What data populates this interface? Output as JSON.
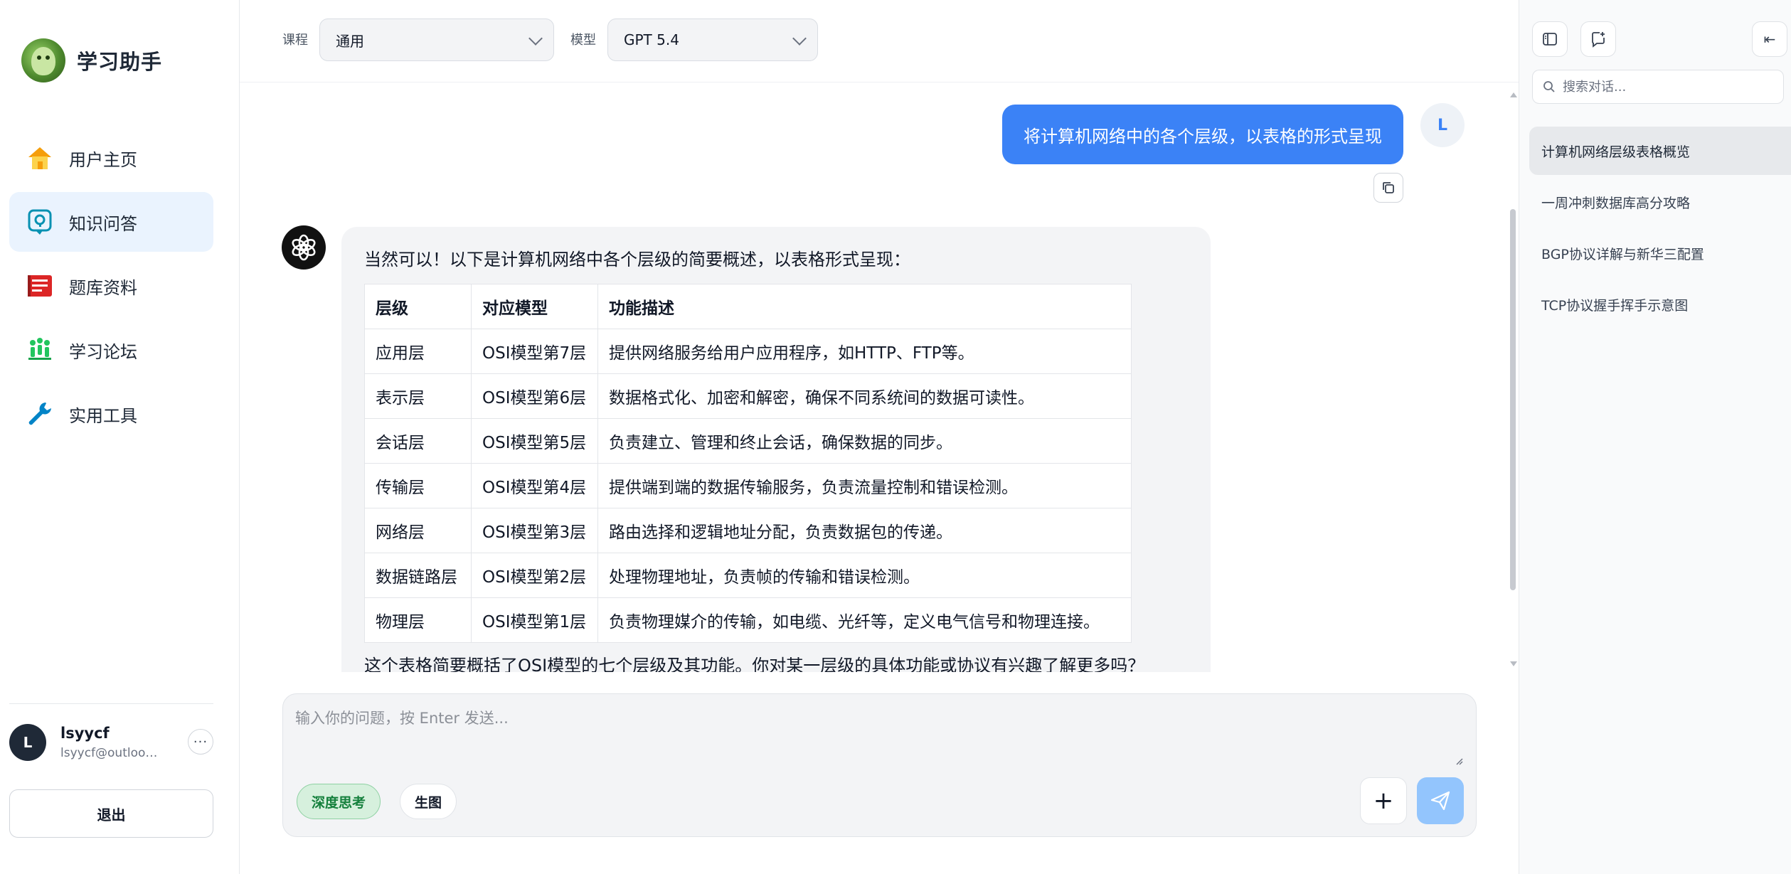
{
  "brand": {
    "title": "学习助手"
  },
  "nav": {
    "items": [
      {
        "label": "用户主页",
        "icon": "home-icon"
      },
      {
        "label": "知识问答",
        "icon": "qa-icon",
        "active": true
      },
      {
        "label": "题库资料",
        "icon": "question-bank-icon"
      },
      {
        "label": "学习论坛",
        "icon": "forum-icon"
      },
      {
        "label": "实用工具",
        "icon": "wrench-icon"
      }
    ]
  },
  "user": {
    "initial": "L",
    "name": "lsyycf",
    "email": "lsyycf@outloo…",
    "more": "···",
    "logout": "退出"
  },
  "topbar": {
    "course_label": "课程",
    "course_value": "通用",
    "model_label": "模型",
    "model_value": "GPT 5.4"
  },
  "chat": {
    "user_message": "将计算机网络中的各个层级，以表格的形式呈现",
    "user_initial": "L",
    "bot_intro": "当然可以！以下是计算机网络中各个层级的简要概述，以表格形式呈现：",
    "table": {
      "headers": [
        "层级",
        "对应模型",
        "功能描述"
      ],
      "rows": [
        [
          "应用层",
          "OSI模型第7层",
          "提供网络服务给用户应用程序，如HTTP、FTP等。"
        ],
        [
          "表示层",
          "OSI模型第6层",
          "数据格式化、加密和解密，确保不同系统间的数据可读性。"
        ],
        [
          "会话层",
          "OSI模型第5层",
          "负责建立、管理和终止会话，确保数据的同步。"
        ],
        [
          "传输层",
          "OSI模型第4层",
          "提供端到端的数据传输服务，负责流量控制和错误检测。"
        ],
        [
          "网络层",
          "OSI模型第3层",
          "路由选择和逻辑地址分配，负责数据包的传递。"
        ],
        [
          "数据链路层",
          "OSI模型第2层",
          "处理物理地址，负责帧的传输和错误检测。"
        ],
        [
          "物理层",
          "OSI模型第1层",
          "负责物理媒介的传输，如电缆、光纤等，定义电气信号和物理连接。"
        ]
      ]
    },
    "bot_outro": "这个表格简要概括了OSI模型的七个层级及其功能。你对某一层级的具体功能或协议有兴趣了解更多吗？"
  },
  "composer": {
    "placeholder": "输入你的问题，按 Enter 发送...",
    "deep_think": "深度思考",
    "image_gen": "生图",
    "plus": "+"
  },
  "sidebar_right": {
    "search_placeholder": "搜索对话...",
    "collapse_glyph": "⇤",
    "conversations": [
      {
        "title": "计算机网络层级表格概览",
        "active": true
      },
      {
        "title": "一周冲刺数据库高分攻略"
      },
      {
        "title": "BGP协议详解与新华三配置"
      },
      {
        "title": "TCP协议握手挥手示意图"
      }
    ]
  },
  "colors": {
    "accent": "#3b82f6",
    "active_nav": "#eaf3fe",
    "send_disabled": "#93c5fd",
    "deep_think_bg": "#d6f0dd"
  }
}
